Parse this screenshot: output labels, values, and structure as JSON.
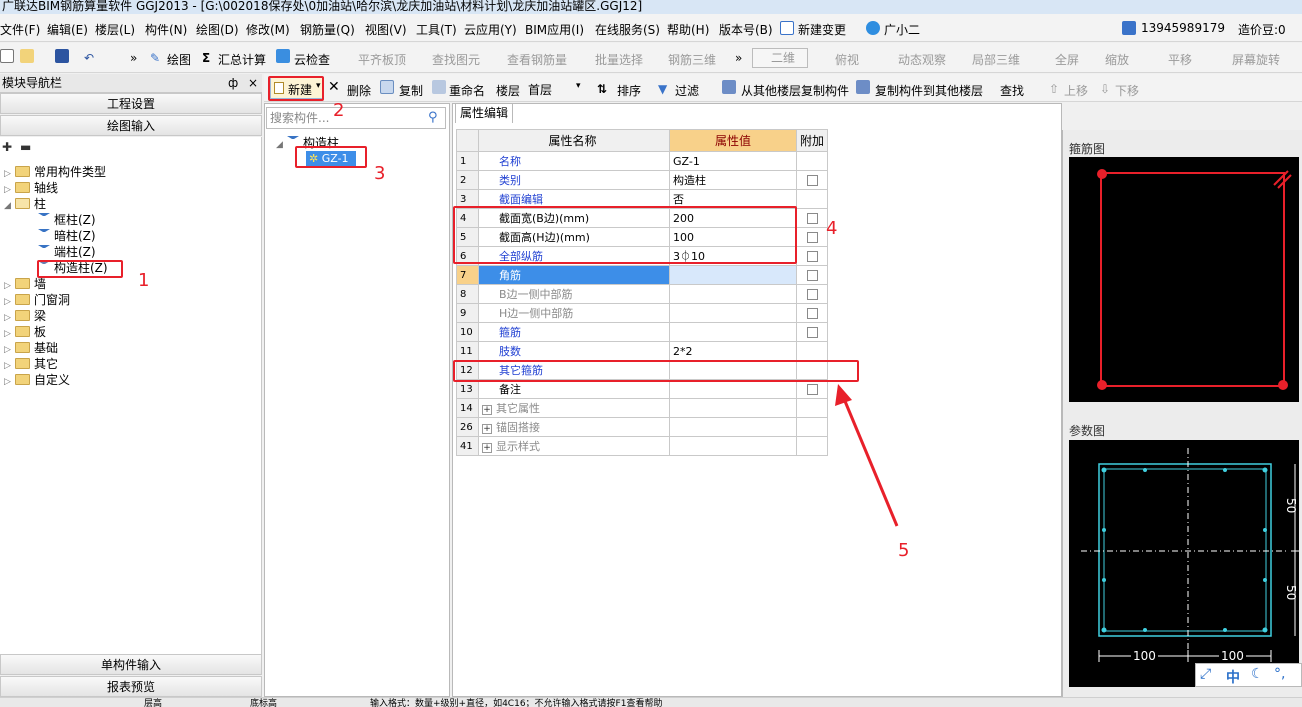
{
  "window": {
    "title": "广联达BIM钢筋算量软件 GGJ2013 - [G:\\002018保存处\\0加油站\\哈尔滨\\龙庆加油站\\材料计划\\龙庆加油站罐区.GGJ12]"
  },
  "menu": {
    "items": [
      "文件(F)",
      "编辑(E)",
      "楼层(L)",
      "构件(N)",
      "绘图(D)",
      "修改(M)",
      "钢筋量(Q)",
      "视图(V)",
      "工具(T)",
      "云应用(Y)",
      "BIM应用(I)",
      "在线服务(S)",
      "帮助(H)",
      "版本号(B)",
      "新建变更",
      "广小二"
    ],
    "phone": "13945989179",
    "cost_beans": "造价豆:0"
  },
  "toolbar1": {
    "items": [
      "绘图",
      "汇总计算",
      "云检查",
      "平齐板顶",
      "查找图元",
      "查看钢筋量",
      "批量选择",
      "钢筋三维",
      "二维",
      "俯视",
      "动态观察",
      "局部三维",
      "全屏",
      "缩放",
      "平移",
      "屏幕旋转"
    ]
  },
  "nav": {
    "title": "模块导航栏",
    "pin": "ф",
    "close": "×",
    "engineering_settings": "工程设置",
    "drawing_input": "绘图输入",
    "tree": [
      {
        "label": "常用构件类型",
        "level": 0
      },
      {
        "label": "轴线",
        "level": 0
      },
      {
        "label": "柱",
        "level": 0
      },
      {
        "label": "框柱(Z)",
        "level": 1
      },
      {
        "label": "暗柱(Z)",
        "level": 1
      },
      {
        "label": "端柱(Z)",
        "level": 1
      },
      {
        "label": "构造柱(Z)",
        "level": 1
      },
      {
        "label": "墙",
        "level": 0
      },
      {
        "label": "门窗洞",
        "level": 0
      },
      {
        "label": "梁",
        "level": 0
      },
      {
        "label": "板",
        "level": 0
      },
      {
        "label": "基础",
        "level": 0
      },
      {
        "label": "其它",
        "level": 0
      },
      {
        "label": "自定义",
        "level": 0
      }
    ],
    "single_input": "单构件输入",
    "report_preview": "报表预览"
  },
  "toolbar2": {
    "new": "新建",
    "delete": "删除",
    "copy": "复制",
    "rename": "重命名",
    "floor_label": "楼层",
    "floor_value": "首层",
    "sort": "排序",
    "filter": "过滤",
    "copy_from": "从其他楼层复制构件",
    "copy_to": "复制构件到其他楼层",
    "find": "查找",
    "move_up": "上移",
    "move_down": "下移"
  },
  "component_panel": {
    "search_placeholder": "搜索构件...",
    "root": "构造柱",
    "child": "GZ-1"
  },
  "props": {
    "tab": "属性编辑",
    "header_name": "属性名称",
    "header_value": "属性值",
    "header_add": "附加",
    "rows": [
      {
        "num": "1",
        "name": "名称",
        "value": "GZ-1"
      },
      {
        "num": "2",
        "name": "类别",
        "value": "构造柱"
      },
      {
        "num": "3",
        "name": "截面编辑",
        "value": "否"
      },
      {
        "num": "4",
        "name": "截面宽(B边)(mm)",
        "value": "200"
      },
      {
        "num": "5",
        "name": "截面高(H边)(mm)",
        "value": "100"
      },
      {
        "num": "6",
        "name": "全部纵筋",
        "value": "3⏀10"
      },
      {
        "num": "7",
        "name": "角筋",
        "value": ""
      },
      {
        "num": "8",
        "name": "B边一侧中部筋",
        "value": ""
      },
      {
        "num": "9",
        "name": "H边一侧中部筋",
        "value": ""
      },
      {
        "num": "10",
        "name": "箍筋",
        "value": ""
      },
      {
        "num": "11",
        "name": "肢数",
        "value": "2*2"
      },
      {
        "num": "12",
        "name": "其它箍筋",
        "value": ""
      },
      {
        "num": "13",
        "name": "备注",
        "value": ""
      },
      {
        "num": "14",
        "name": "其它属性",
        "value": ""
      },
      {
        "num": "26",
        "name": "锚固搭接",
        "value": ""
      },
      {
        "num": "41",
        "name": "显示样式",
        "value": ""
      }
    ]
  },
  "right": {
    "stirrup_title": "箍筋图",
    "param_title": "参数图",
    "dim_right_top": "50",
    "dim_right_bottom": "50",
    "dim_bottom_left": "100",
    "dim_bottom_right": "100"
  },
  "ime": {
    "label": "中"
  },
  "annotations": [
    "1",
    "2",
    "3",
    "4",
    "5"
  ],
  "status": {
    "floor_height": "层高",
    "floor_bottom_elev": "底标高",
    "hint": "输入格式：数量+级别+直径，如4C16；不允许输入格式请按F1查看帮助"
  },
  "colors": {
    "highlight": "#e8202a",
    "selection": "#3d8ee8",
    "header_value": "#f8d18a",
    "link_blue": "#1f3fd2"
  }
}
